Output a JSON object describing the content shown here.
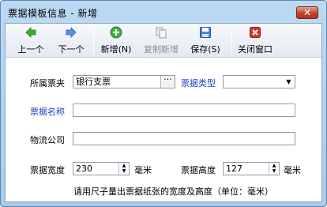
{
  "window": {
    "title": "票据模板信息 - 新增",
    "close_glyph": "✕"
  },
  "toolbar": {
    "prev": "上一个",
    "next": "下一个",
    "new": "新增(N)",
    "copy_new": "复制新增",
    "save": "保存(S)",
    "close": "关闭窗口"
  },
  "form": {
    "ticket_book_label": "所属票夹",
    "ticket_book_value": "银行支票",
    "ticket_type_label": "票据类型",
    "ticket_type_value": "",
    "ticket_name_label": "票据名称",
    "ticket_name_value": "",
    "logistics_label": "物流公司",
    "logistics_value": "",
    "width_label": "票据宽度",
    "width_value": "230",
    "width_unit": "毫米",
    "height_label": "票据高度",
    "height_value": "127",
    "height_unit": "毫米",
    "hint": "请用尺子量出票据纸张的宽度及高度（单位：毫米）"
  },
  "colors": {
    "link": "#1f3fc4",
    "titlebar": "#bcd9f2"
  }
}
